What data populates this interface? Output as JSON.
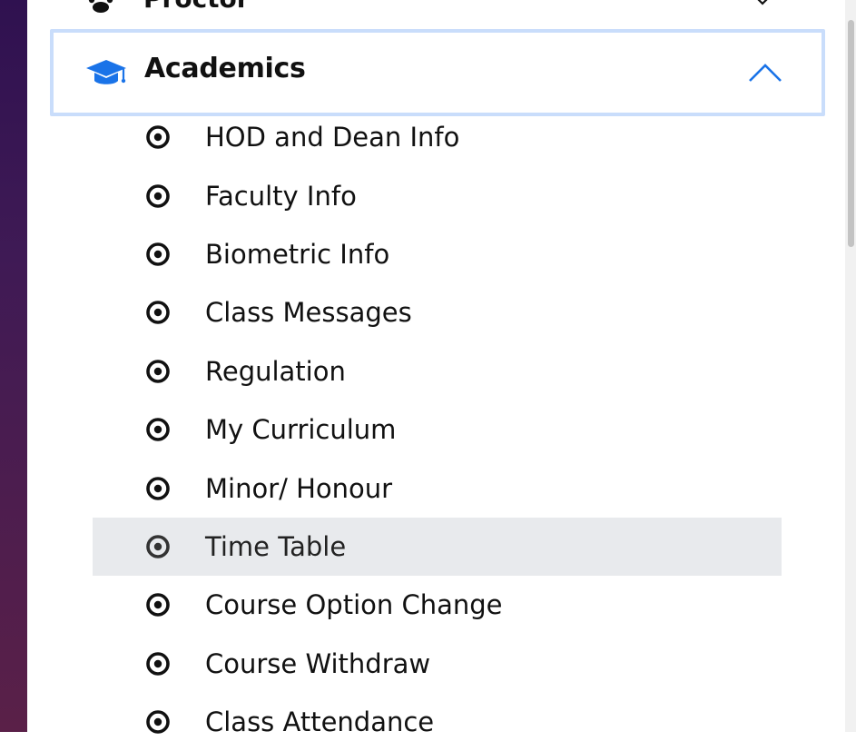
{
  "proctor": {
    "label": "Proctor",
    "icon": "paw-icon",
    "chevron": "chevron-down-icon"
  },
  "academics": {
    "label": "Academics",
    "icon": "graduation-cap-icon",
    "chevron": "chevron-up-icon",
    "accent": "#1a73e8",
    "border_color": "#c9ddfb"
  },
  "menu": {
    "items": [
      {
        "label": "HOD and Dean Info",
        "active": false
      },
      {
        "label": "Faculty Info",
        "active": false
      },
      {
        "label": "Biometric Info",
        "active": false
      },
      {
        "label": "Class Messages",
        "active": false
      },
      {
        "label": "Regulation",
        "active": false
      },
      {
        "label": "My Curriculum",
        "active": false
      },
      {
        "label": "Minor/ Honour",
        "active": false
      },
      {
        "label": "Time Table",
        "active": true
      },
      {
        "label": "Course Option Change",
        "active": false
      },
      {
        "label": "Course Withdraw",
        "active": false
      },
      {
        "label": "Class Attendance",
        "active": false
      }
    ],
    "bullet_icon": "radio-bullet-icon",
    "active_bg": "#e8eaed"
  }
}
